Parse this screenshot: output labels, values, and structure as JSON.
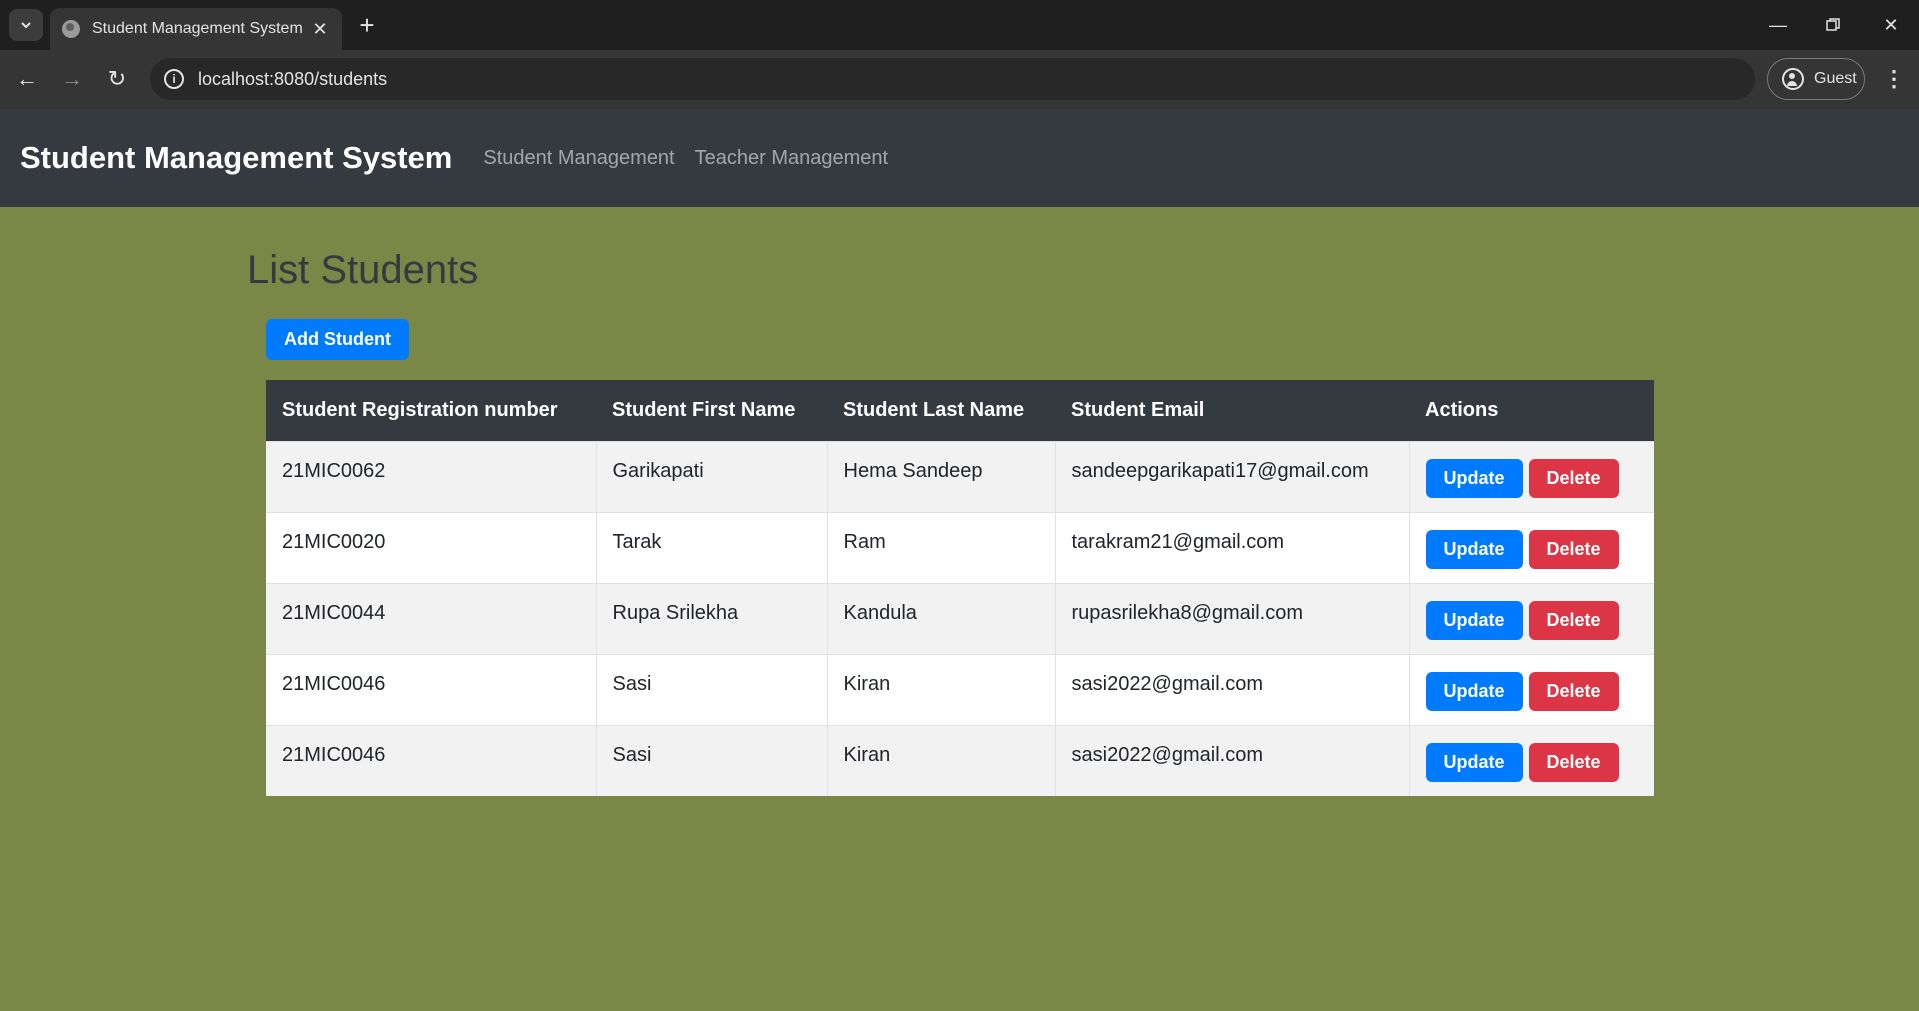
{
  "browser": {
    "tab_title": "Student Management System",
    "url": "localhost:8080/students",
    "profile_label": "Guest"
  },
  "navbar": {
    "brand": "Student Management System",
    "links": [
      "Student Management",
      "Teacher Management"
    ]
  },
  "page": {
    "title": "List Students",
    "add_button": "Add Student"
  },
  "table": {
    "headers": [
      "Student Registration number",
      "Student First Name",
      "Student Last Name",
      "Student Email",
      "Actions"
    ],
    "rows": [
      {
        "reg": "21MIC0062",
        "first": "Garikapati",
        "last": "Hema Sandeep",
        "email": "sandeepgarikapati17@gmail.com"
      },
      {
        "reg": "21MIC0020",
        "first": "Tarak",
        "last": "Ram",
        "email": "tarakram21@gmail.com"
      },
      {
        "reg": "21MIC0044",
        "first": "Rupa Srilekha",
        "last": "Kandula",
        "email": "rupasrilekha8@gmail.com"
      },
      {
        "reg": "21MIC0046",
        "first": "Sasi",
        "last": "Kiran",
        "email": "sasi2022@gmail.com"
      },
      {
        "reg": "21MIC0046",
        "first": "Sasi",
        "last": "Kiran",
        "email": "sasi2022@gmail.com"
      }
    ],
    "update_label": "Update",
    "delete_label": "Delete"
  },
  "colors": {
    "page_background": "#7a8746",
    "navbar": "#343a40",
    "primary": "#007bff",
    "danger": "#dc3545"
  }
}
